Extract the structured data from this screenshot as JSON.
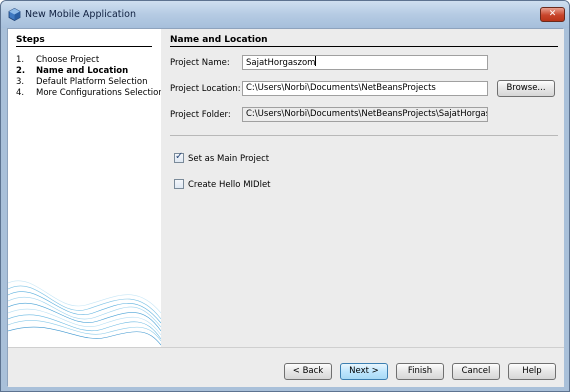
{
  "window": {
    "title": "New Mobile Application",
    "close_label": "✕"
  },
  "steps": {
    "title": "Steps",
    "items": [
      {
        "num": "1.",
        "label": "Choose Project"
      },
      {
        "num": "2.",
        "label": "Name and Location"
      },
      {
        "num": "3.",
        "label": "Default Platform Selection"
      },
      {
        "num": "4.",
        "label": "More Configurations Selection"
      }
    ],
    "active_index": 1
  },
  "form": {
    "section_title": "Name and Location",
    "project_name_label": "Project Name:",
    "project_name_value": "SajatHorgaszom",
    "project_location_label": "Project Location:",
    "project_location_value": "C:\\Users\\Norbi\\Documents\\NetBeansProjects",
    "browse_label": "Browse...",
    "project_folder_label": "Project Folder:",
    "project_folder_value": "C:\\Users\\Norbi\\Documents\\NetBeansProjects\\SajatHorgaszom",
    "main_project_label": "Set as Main Project",
    "main_project_checked": true,
    "hello_midlet_label": "Create Hello MIDlet",
    "hello_midlet_checked": false,
    "checkmark": "✓"
  },
  "buttons": {
    "back": "< Back",
    "next": "Next >",
    "finish": "Finish",
    "cancel": "Cancel",
    "help": "Help"
  }
}
